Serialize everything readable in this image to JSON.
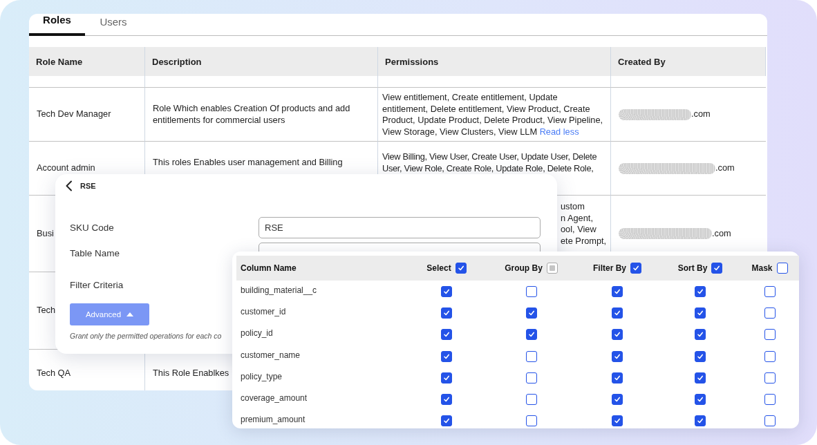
{
  "tabs": [
    {
      "label": "Roles",
      "selected": true
    },
    {
      "label": "Users",
      "selected": false
    }
  ],
  "roles_table": {
    "columns": [
      "Role Name",
      "Description",
      "Permissions",
      "Created By"
    ],
    "rows": [
      {
        "role": "Tech Dev Manager",
        "description": "Role Which enables Creation Of products and add entitlements for commercial users",
        "permissions": "View entitlement, Create entitlement, Update entitlement, Delete entitlement, View Product, Create Product, Update Product, Delete Product, View Pipeline, View Storage, View Clusters, View LLM",
        "link": "Read less",
        "created_by": ".com"
      },
      {
        "role": "Account admin",
        "description": "This roles Enables user management and Billing",
        "permissions": "View Billing, View User, Create User, Update User, Delete User, View Role, Create Role, Update Role, Delete Role,",
        "created_by": ".com"
      },
      {
        "role": "Busi",
        "permissions_tail": "ustom\nn Agent,\nool, View\nete Prompt,",
        "created_by": ".com"
      },
      {
        "role": "Tech"
      },
      {
        "role": "Tech QA",
        "description": "This Role Enablkes"
      }
    ]
  },
  "detail_panel": {
    "title": "RSE",
    "sku_code": {
      "label": "SKU Code",
      "value": "RSE"
    },
    "table_name": {
      "label": "Table Name"
    },
    "filter_criteria": {
      "label": "Filter Criteria"
    },
    "advanced_button": "Advanced",
    "hint": "Grant only the permitted operations for each co"
  },
  "column_grid": {
    "columns": [
      {
        "label": "Column Name",
        "kind": "text"
      },
      {
        "label": "Select",
        "kind": "checkbox",
        "checked": true,
        "indeterminate": false
      },
      {
        "label": "Group By",
        "kind": "checkbox",
        "checked": false,
        "indeterminate": true
      },
      {
        "label": "Filter By",
        "kind": "checkbox",
        "checked": true,
        "indeterminate": false
      },
      {
        "label": "Sort By",
        "kind": "checkbox",
        "checked": true,
        "indeterminate": false
      },
      {
        "label": "Mask",
        "kind": "checkbox",
        "checked": false,
        "indeterminate": false
      }
    ],
    "rows": [
      {
        "name": "building_material__c",
        "values": [
          true,
          false,
          true,
          true,
          false
        ]
      },
      {
        "name": "customer_id",
        "values": [
          true,
          true,
          true,
          true,
          false
        ]
      },
      {
        "name": "policy_id",
        "values": [
          true,
          true,
          true,
          true,
          false
        ]
      },
      {
        "name": "customer_name",
        "values": [
          true,
          false,
          true,
          true,
          false
        ]
      },
      {
        "name": "policy_type",
        "values": [
          true,
          false,
          true,
          true,
          false
        ]
      },
      {
        "name": "coverage_amount",
        "values": [
          true,
          false,
          true,
          true,
          false
        ]
      },
      {
        "name": "premium_amount",
        "values": [
          true,
          false,
          true,
          true,
          false
        ]
      }
    ]
  }
}
